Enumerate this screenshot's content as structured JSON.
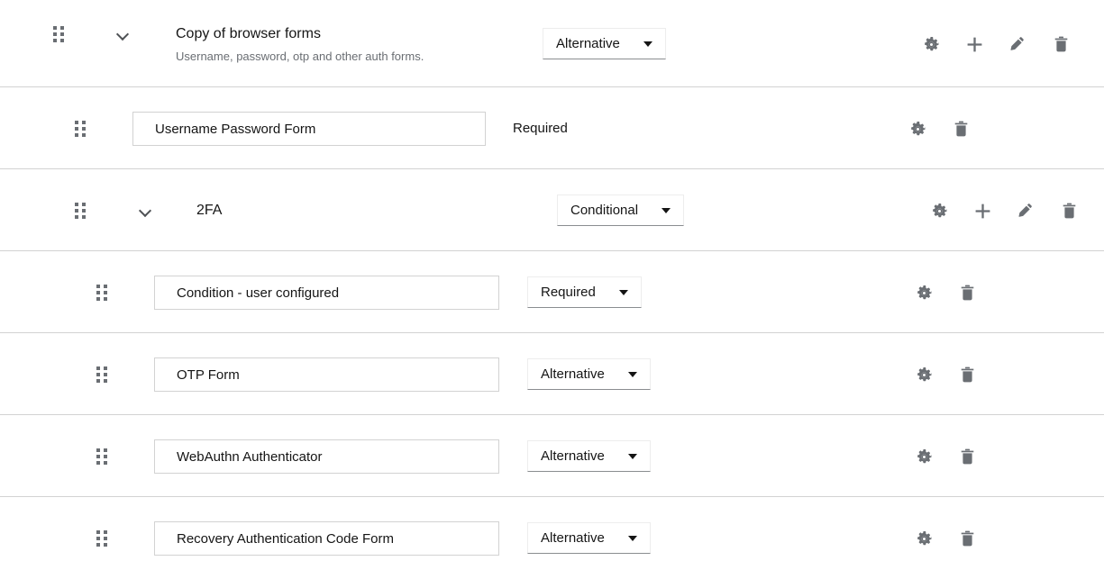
{
  "flow": {
    "rows": [
      {
        "id": "copy-of-browser-forms",
        "type": "group",
        "level": 0,
        "drag_handle": "drag-handle-icon",
        "chevron": "chevron-down-icon",
        "title": "Copy of browser forms",
        "description": "Username, password, otp and other auth forms.",
        "requirement": "Alternative",
        "requirement_control": "select",
        "actions": [
          "gear-icon",
          "plus-icon",
          "pencil-icon",
          "trash-icon"
        ]
      },
      {
        "id": "username-password-form",
        "type": "execution",
        "level": 1,
        "drag_handle": "drag-handle-icon",
        "chevron": null,
        "title": "Username Password Form",
        "description": null,
        "requirement": "Required",
        "requirement_control": "text",
        "actions": [
          "gear-icon",
          "trash-icon"
        ]
      },
      {
        "id": "2fa",
        "type": "group",
        "level": 1,
        "drag_handle": "drag-handle-icon",
        "chevron": "chevron-down-icon",
        "title": "2FA",
        "description": null,
        "requirement": "Conditional",
        "requirement_control": "select",
        "actions": [
          "gear-icon",
          "plus-icon",
          "pencil-icon",
          "trash-icon"
        ]
      },
      {
        "id": "condition-user-configured",
        "type": "execution",
        "level": 2,
        "drag_handle": "drag-handle-icon",
        "chevron": null,
        "title": "Condition - user configured",
        "description": null,
        "requirement": "Required",
        "requirement_control": "select",
        "actions": [
          "gear-icon",
          "trash-icon"
        ]
      },
      {
        "id": "otp-form",
        "type": "execution",
        "level": 2,
        "drag_handle": "drag-handle-icon",
        "chevron": null,
        "title": "OTP Form",
        "description": null,
        "requirement": "Alternative",
        "requirement_control": "select",
        "actions": [
          "gear-icon",
          "trash-icon"
        ]
      },
      {
        "id": "webauthn-authenticator",
        "type": "execution",
        "level": 2,
        "drag_handle": "drag-handle-icon",
        "chevron": null,
        "title": "WebAuthn Authenticator",
        "description": null,
        "requirement": "Alternative",
        "requirement_control": "select",
        "actions": [
          "gear-icon",
          "trash-icon"
        ]
      },
      {
        "id": "recovery-authentication-code-form",
        "type": "execution",
        "level": 2,
        "drag_handle": "drag-handle-icon",
        "chevron": null,
        "title": "Recovery Authentication Code Form",
        "description": null,
        "requirement": "Alternative",
        "requirement_control": "select",
        "actions": [
          "gear-icon",
          "trash-icon"
        ]
      }
    ]
  },
  "colors": {
    "divider": "#d2d2d2",
    "icon": "#6a6e73",
    "text_primary": "#151515",
    "text_secondary": "#6a6e73",
    "input_border": "#d2d2d2",
    "select_underline": "#8a8d90",
    "background": "#ffffff"
  }
}
